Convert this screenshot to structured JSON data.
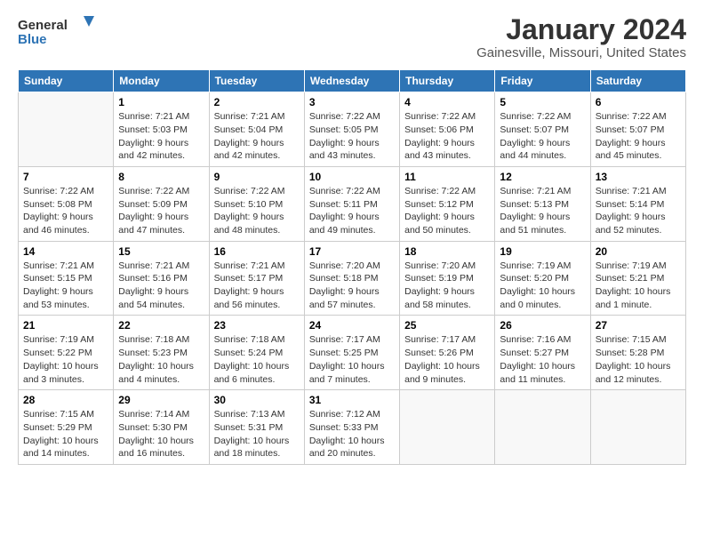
{
  "header": {
    "logo_line1": "General",
    "logo_line2": "Blue",
    "title": "January 2024",
    "subtitle": "Gainesville, Missouri, United States"
  },
  "calendar": {
    "days_of_week": [
      "Sunday",
      "Monday",
      "Tuesday",
      "Wednesday",
      "Thursday",
      "Friday",
      "Saturday"
    ],
    "weeks": [
      [
        {
          "day": "",
          "sunrise": "",
          "sunset": "",
          "daylight": ""
        },
        {
          "day": "1",
          "sunrise": "7:21 AM",
          "sunset": "5:03 PM",
          "daylight": "9 hours and 42 minutes."
        },
        {
          "day": "2",
          "sunrise": "7:21 AM",
          "sunset": "5:04 PM",
          "daylight": "9 hours and 42 minutes."
        },
        {
          "day": "3",
          "sunrise": "7:22 AM",
          "sunset": "5:05 PM",
          "daylight": "9 hours and 43 minutes."
        },
        {
          "day": "4",
          "sunrise": "7:22 AM",
          "sunset": "5:06 PM",
          "daylight": "9 hours and 43 minutes."
        },
        {
          "day": "5",
          "sunrise": "7:22 AM",
          "sunset": "5:07 PM",
          "daylight": "9 hours and 44 minutes."
        },
        {
          "day": "6",
          "sunrise": "7:22 AM",
          "sunset": "5:07 PM",
          "daylight": "9 hours and 45 minutes."
        }
      ],
      [
        {
          "day": "7",
          "sunrise": "7:22 AM",
          "sunset": "5:08 PM",
          "daylight": "9 hours and 46 minutes."
        },
        {
          "day": "8",
          "sunrise": "7:22 AM",
          "sunset": "5:09 PM",
          "daylight": "9 hours and 47 minutes."
        },
        {
          "day": "9",
          "sunrise": "7:22 AM",
          "sunset": "5:10 PM",
          "daylight": "9 hours and 48 minutes."
        },
        {
          "day": "10",
          "sunrise": "7:22 AM",
          "sunset": "5:11 PM",
          "daylight": "9 hours and 49 minutes."
        },
        {
          "day": "11",
          "sunrise": "7:22 AM",
          "sunset": "5:12 PM",
          "daylight": "9 hours and 50 minutes."
        },
        {
          "day": "12",
          "sunrise": "7:21 AM",
          "sunset": "5:13 PM",
          "daylight": "9 hours and 51 minutes."
        },
        {
          "day": "13",
          "sunrise": "7:21 AM",
          "sunset": "5:14 PM",
          "daylight": "9 hours and 52 minutes."
        }
      ],
      [
        {
          "day": "14",
          "sunrise": "7:21 AM",
          "sunset": "5:15 PM",
          "daylight": "9 hours and 53 minutes."
        },
        {
          "day": "15",
          "sunrise": "7:21 AM",
          "sunset": "5:16 PM",
          "daylight": "9 hours and 54 minutes."
        },
        {
          "day": "16",
          "sunrise": "7:21 AM",
          "sunset": "5:17 PM",
          "daylight": "9 hours and 56 minutes."
        },
        {
          "day": "17",
          "sunrise": "7:20 AM",
          "sunset": "5:18 PM",
          "daylight": "9 hours and 57 minutes."
        },
        {
          "day": "18",
          "sunrise": "7:20 AM",
          "sunset": "5:19 PM",
          "daylight": "9 hours and 58 minutes."
        },
        {
          "day": "19",
          "sunrise": "7:19 AM",
          "sunset": "5:20 PM",
          "daylight": "10 hours and 0 minutes."
        },
        {
          "day": "20",
          "sunrise": "7:19 AM",
          "sunset": "5:21 PM",
          "daylight": "10 hours and 1 minute."
        }
      ],
      [
        {
          "day": "21",
          "sunrise": "7:19 AM",
          "sunset": "5:22 PM",
          "daylight": "10 hours and 3 minutes."
        },
        {
          "day": "22",
          "sunrise": "7:18 AM",
          "sunset": "5:23 PM",
          "daylight": "10 hours and 4 minutes."
        },
        {
          "day": "23",
          "sunrise": "7:18 AM",
          "sunset": "5:24 PM",
          "daylight": "10 hours and 6 minutes."
        },
        {
          "day": "24",
          "sunrise": "7:17 AM",
          "sunset": "5:25 PM",
          "daylight": "10 hours and 7 minutes."
        },
        {
          "day": "25",
          "sunrise": "7:17 AM",
          "sunset": "5:26 PM",
          "daylight": "10 hours and 9 minutes."
        },
        {
          "day": "26",
          "sunrise": "7:16 AM",
          "sunset": "5:27 PM",
          "daylight": "10 hours and 11 minutes."
        },
        {
          "day": "27",
          "sunrise": "7:15 AM",
          "sunset": "5:28 PM",
          "daylight": "10 hours and 12 minutes."
        }
      ],
      [
        {
          "day": "28",
          "sunrise": "7:15 AM",
          "sunset": "5:29 PM",
          "daylight": "10 hours and 14 minutes."
        },
        {
          "day": "29",
          "sunrise": "7:14 AM",
          "sunset": "5:30 PM",
          "daylight": "10 hours and 16 minutes."
        },
        {
          "day": "30",
          "sunrise": "7:13 AM",
          "sunset": "5:31 PM",
          "daylight": "10 hours and 18 minutes."
        },
        {
          "day": "31",
          "sunrise": "7:12 AM",
          "sunset": "5:33 PM",
          "daylight": "10 hours and 20 minutes."
        },
        {
          "day": "",
          "sunrise": "",
          "sunset": "",
          "daylight": ""
        },
        {
          "day": "",
          "sunrise": "",
          "sunset": "",
          "daylight": ""
        },
        {
          "day": "",
          "sunrise": "",
          "sunset": "",
          "daylight": ""
        }
      ]
    ],
    "labels": {
      "sunrise": "Sunrise:",
      "sunset": "Sunset:",
      "daylight": "Daylight:"
    }
  }
}
